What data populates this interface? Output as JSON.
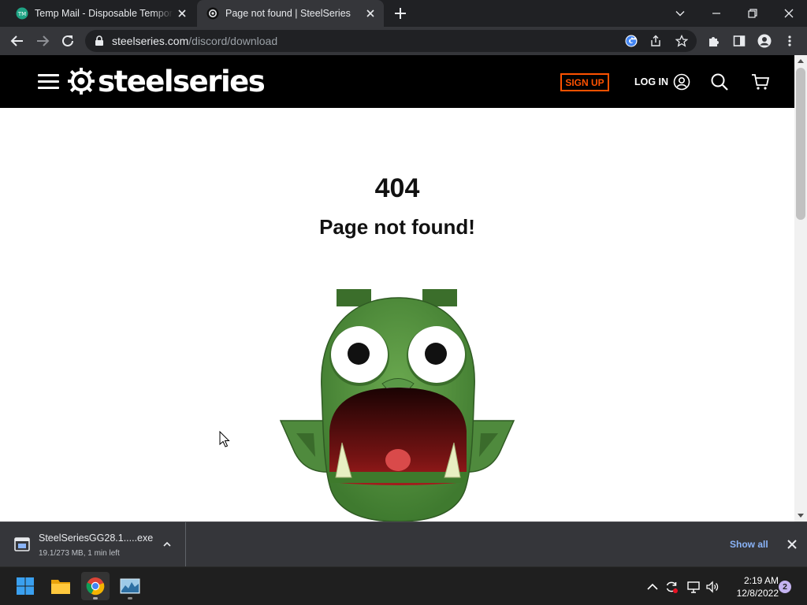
{
  "browser": {
    "tabs": [
      {
        "title": "Temp Mail - Disposable Temporary E",
        "favicon": "tempmail-favicon",
        "active": false
      },
      {
        "title": "Page not found | SteelSeries",
        "favicon": "steelseries-favicon",
        "active": true
      }
    ],
    "address_bar": {
      "domain": "steelseries.com",
      "path": "/discord/download"
    }
  },
  "site": {
    "brand": "steelseries",
    "signup_label": "SIGN UP",
    "login_label": "LOG IN",
    "accent_color": "#ff5200"
  },
  "page": {
    "error_code": "404",
    "error_message": "Page not found!"
  },
  "downloads": {
    "filename": "SteelSeriesGG28.1.....exe",
    "status": "19.1/273 MB, 1 min left",
    "show_all_label": "Show all"
  },
  "taskbar": {
    "time": "2:19 AM",
    "date": "12/8/2022",
    "notification_count": "2"
  }
}
